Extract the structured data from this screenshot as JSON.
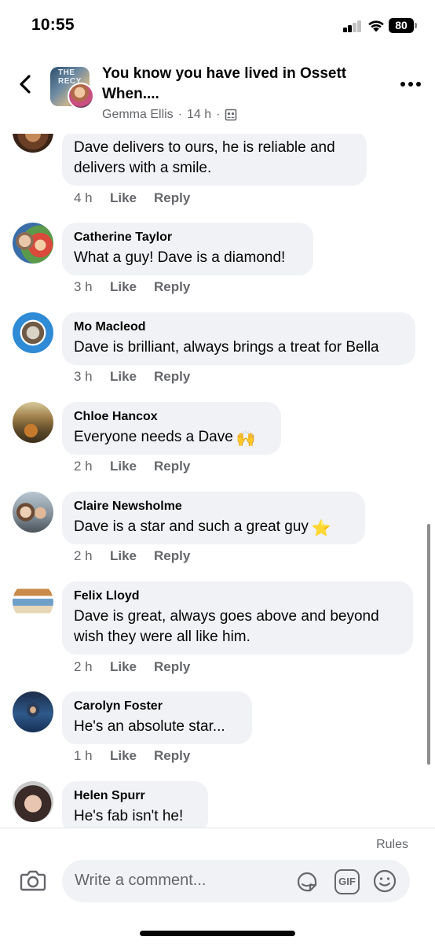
{
  "status_bar": {
    "time": "10:55",
    "battery": "80"
  },
  "header": {
    "group_title": "You know you have lived in Ossett When....",
    "thumb_text": "THE RECY",
    "author": "Gemma Ellis",
    "separator": "·",
    "time": "14 h"
  },
  "comments": [
    {
      "name": "",
      "text": "Dave delivers to ours, he is reliable and delivers with a smile.",
      "time": "4 h",
      "like": "Like",
      "reply": "Reply"
    },
    {
      "name": "Catherine Taylor",
      "text": "What a guy! Dave is a diamond!",
      "time": "3 h",
      "like": "Like",
      "reply": "Reply"
    },
    {
      "name": "Mo Macleod",
      "text": "Dave is brilliant, always brings a treat for Bella",
      "time": "3 h",
      "like": "Like",
      "reply": "Reply"
    },
    {
      "name": "Chloe Hancox",
      "text": "Everyone needs a Dave",
      "emoji": "🙌",
      "time": "2 h",
      "like": "Like",
      "reply": "Reply"
    },
    {
      "name": "Claire Newsholme",
      "text": "Dave is a star and such a great guy",
      "emoji": "⭐",
      "time": "2 h",
      "like": "Like",
      "reply": "Reply"
    },
    {
      "name": "Felix Lloyd",
      "text": "Dave is great, always goes above and beyond wish they were all like him.",
      "time": "2 h",
      "like": "Like",
      "reply": "Reply"
    },
    {
      "name": "Carolyn Foster",
      "text": "He's an absolute star...",
      "time": "1 h",
      "like": "Like",
      "reply": "Reply"
    },
    {
      "name": "Helen Spurr",
      "text": "He's fab isn't he!",
      "time": "",
      "like": "",
      "reply": ""
    }
  ],
  "composer": {
    "rules": "Rules",
    "placeholder": "Write a comment...",
    "gif_label": "GIF"
  },
  "icons": {
    "back": "chevron-left-icon",
    "more": "more-dots-icon",
    "camera": "camera-icon",
    "sticker": "sticker-icon",
    "gif": "gif-icon",
    "emoji": "smiley-icon",
    "privacy": "members-only-icon"
  },
  "colors": {
    "bubble": "#f0f2f5",
    "secondary_text": "#65676b",
    "primary_text": "#050505"
  }
}
